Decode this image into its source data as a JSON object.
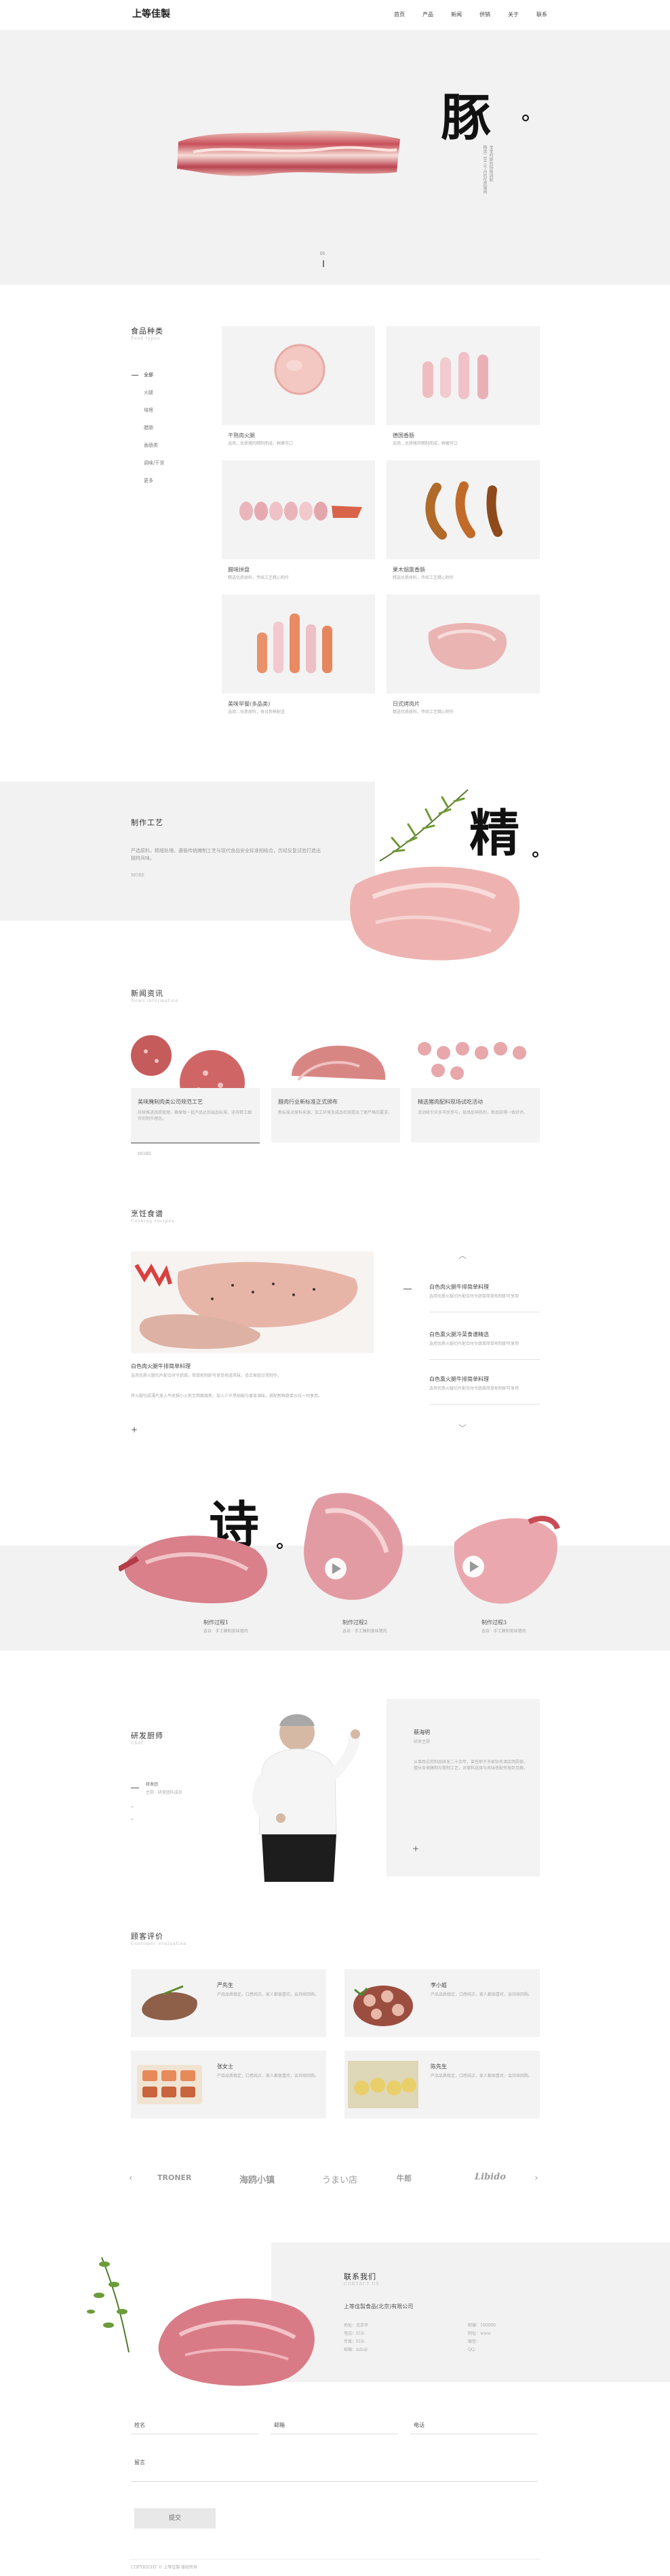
{
  "header": {
    "logo": "上等佳製",
    "nav": [
      "首页",
      "产品",
      "新闻",
      "供销",
      "关于",
      "联系"
    ]
  },
  "hero": {
    "char": "豚",
    "vertical_text": "宝宝时期的特殊调制\n精选二至三个月的优质猪肉",
    "pager": "01"
  },
  "categories": {
    "title": "食品种类",
    "subtitle": "Food types",
    "items": [
      "全部",
      "火腿",
      "培根",
      "腊肠",
      "香肠类",
      "调味/干货",
      "更多"
    ],
    "products": [
      {
        "name": "干熟肉火腿",
        "desc": "选用…优质猪肉精制而成，鲜嫩可口"
      },
      {
        "name": "德国香肠",
        "desc": "选用…优质猪肉精制而成，鲜嫩可口"
      },
      {
        "name": "腊味拼盘",
        "desc": "精选优质原料，传统工艺精心制作"
      },
      {
        "name": "果木烟熏香肠",
        "desc": "精选优质原料，传统工艺精心制作"
      },
      {
        "name": "美味早餐(多品类)",
        "desc": "选用…优质原料，每日新鲜配送"
      },
      {
        "name": "日式烤肉片",
        "desc": "精选优质原料，传统工艺精心制作"
      }
    ]
  },
  "craft": {
    "title": "制作工艺",
    "text": "严选原料，精细处理。遵循传统腌制工艺与现代食品安全标准相结合，历经反复试验打造出独特风味。",
    "more": "MORE",
    "char": "精"
  },
  "news": {
    "title": "新闻资讯",
    "subtitle": "News information",
    "items": [
      {
        "title": "美味腌制肉类公司规范工艺",
        "text": "持续推进品质管理，确保每一批产品达到出品标准，坚持精工细作的制作理念。"
      },
      {
        "title": "腊肉行业新标准正式颁布",
        "text": "新标准对原料来源、加工环境及成品检测提出了更严格的要求。"
      },
      {
        "title": "精选猪肉配料现场试吃活动",
        "text": "活动吸引众多市民参与，现场反响热烈，新品获得一致好评。"
      }
    ],
    "more": "MORE"
  },
  "recipes": {
    "title": "烹饪食谱",
    "subtitle": "Cooking recipes",
    "main_title": "白色肉火腿牛排简单料理",
    "main_text": "选用优质火腿切片配合时令蔬菜，简单煎制即可享受地道风味，适合家庭日常制作。",
    "main_text2": "将火腿切成薄片放入平底锅小火煎至两面微焦，加入少许黑胡椒与香草调味，搭配新鲜蔬菜沙拉一同享用。",
    "list": [
      {
        "title": "白色肉火腿牛排简单料理",
        "text": "选用优质火腿切片配合时令蔬菜简单煎制即可享用"
      },
      {
        "title": "白色熏火腿冷菜食谱精选",
        "text": "选用优质火腿切片配合时令蔬菜简单煎制即可享用"
      },
      {
        "title": "白色熏火腿牛排简单料理",
        "text": "选用优质火腿切片配合时令蔬菜简单煎制即可享用"
      }
    ]
  },
  "poem": {
    "char": "诗",
    "items": [
      {
        "title": "制作过程1",
        "text": "选自 · 手工腌制美味猪肉"
      },
      {
        "title": "制作过程2",
        "text": "选自 · 手工腌制美味猪肉"
      },
      {
        "title": "制作过程3",
        "text": "选自 · 手工腌制美味猪肉"
      }
    ]
  },
  "chef": {
    "title": "研发厨师",
    "subtitle": "Chef",
    "label1": "研发团",
    "label2": "主厨 · 研发团队成员",
    "name": "蔡海明",
    "role": "研发主厨",
    "bio": "从事西式肉制品研发二十余年，曾任职于多家知名酒店西厨部，擅长各类腌制与熏制工艺，对原料选择与风味搭配有独到见解。",
    "plus": "+"
  },
  "cases": {
    "title": "顾客评价",
    "subtitle": "Customer evaluation",
    "items": [
      {
        "name": "严先生",
        "text": "产品品质稳定，口感纯正，家人都很喜欢，会持续回购。"
      },
      {
        "name": "李小姐",
        "text": "产品品质稳定，口感纯正，家人都很喜欢，会持续回购。"
      },
      {
        "name": "张女士",
        "text": "产品品质稳定，口感纯正，家人都很喜欢，会持续回购。"
      },
      {
        "name": "陈先生",
        "text": "产品品质稳定，口感纯正，家人都很喜欢，会持续回购。"
      }
    ]
  },
  "partners": [
    "TRONER",
    "海鸥小镇",
    "うまい店",
    "牛郎",
    "Libido"
  ],
  "contact": {
    "title": "联系我们",
    "subtitle": "CONTACT US",
    "company": "上等佳製食品(北京)有限公司",
    "lines": [
      "地址：北京市",
      "电话：010-",
      "传真：010-",
      "邮箱：info@"
    ],
    "lines2": [
      "邮编：100000",
      "网址：www.",
      "微信：",
      "QQ："
    ],
    "fields": [
      "姓名",
      "邮箱",
      "电话",
      "留言"
    ],
    "submit": "提交"
  },
  "footer": "COPYRIGHT © 上等佳製 版权所有"
}
